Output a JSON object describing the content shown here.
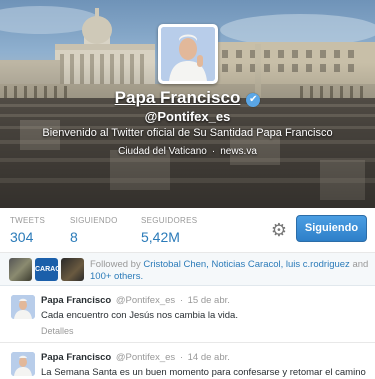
{
  "profile": {
    "display_name": "Papa Francisco",
    "handle": "@Pontifex_es",
    "bio": "Bienvenido al Twitter oficial de Su Santidad Papa Francisco",
    "location": "Ciudad del Vaticano",
    "separator": "·",
    "website": "news.va",
    "verified_icon": "✔"
  },
  "stats": {
    "tweets_label": "TWEETS",
    "tweets_value": "304",
    "following_label": "SIGUIENDO",
    "following_value": "8",
    "followers_label": "SEGUIDORES",
    "followers_value": "5,42M",
    "settings_icon": "gear-icon",
    "follow_button": "Siguiendo"
  },
  "followed_by": {
    "prefix": "Followed by",
    "names": "Cristobal Chen, Noticias Caracol, luis c.rodriguez",
    "connector": "and",
    "more": "100+ others.",
    "mini2_text": "CARACOL"
  },
  "tweets": [
    {
      "name": "Papa Francisco",
      "handle": "@Pontifex_es",
      "sep": "·",
      "date": "15 de abr.",
      "text": "Cada encuentro con Jesús nos cambia la vida.",
      "details": "Detalles"
    },
    {
      "name": "Papa Francisco",
      "handle": "@Pontifex_es",
      "sep": "·",
      "date": "14 de abr.",
      "text": "La Semana Santa es un buen momento para confesarse y retomar el camino"
    }
  ],
  "colors": {
    "link_blue": "#2b7bb9",
    "follow_button": "#2e7fc8",
    "verified": "#5aa6e6"
  }
}
